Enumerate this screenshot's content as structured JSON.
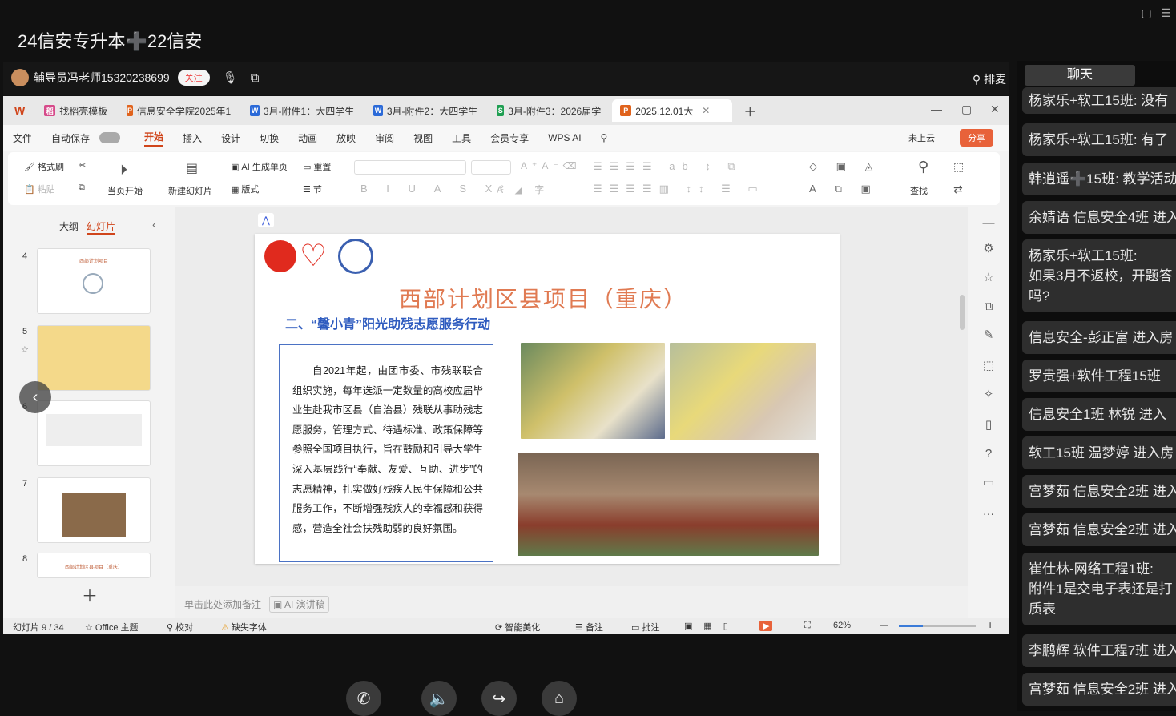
{
  "meeting": {
    "group_title": "24信安专升本➕22信安",
    "sharer_name": "辅导员冯老师15320238699",
    "follow_label": "关注",
    "rank_label": "排麦"
  },
  "wps": {
    "tabs": [
      {
        "label": "找稻壳模板",
        "icon": "docer-icon",
        "color": "#d64a8a"
      },
      {
        "label": "信息安全学院2025年1",
        "icon": "ppt-icon",
        "color": "#e0631d"
      },
      {
        "label": "3月-附件1：大四学生",
        "icon": "word-icon",
        "color": "#2b6ad8"
      },
      {
        "label": "3月-附件2：大四学生",
        "icon": "word-icon",
        "color": "#2b6ad8"
      },
      {
        "label": "3月-附件3：2026届学",
        "icon": "excel-icon",
        "color": "#1f9f52"
      },
      {
        "label": "2025.12.01大",
        "icon": "ppt-icon",
        "color": "#e0631d"
      }
    ],
    "menu": [
      "文件",
      "自动保存",
      "开始",
      "插入",
      "设计",
      "切换",
      "动画",
      "放映",
      "审阅",
      "视图",
      "工具",
      "会员专享",
      "WPS AI"
    ],
    "cloud_label": "未上云",
    "share_label": "分享",
    "ribbon": {
      "format_painter": "格式刷",
      "paste": "粘贴",
      "play_from_current": "当页开始",
      "new_slide": "新建幻灯片",
      "ai_generate": "AI 生成单页",
      "reset": "重置",
      "layout": "版式",
      "section": "节",
      "find": "查找"
    },
    "panel_tabs": {
      "outline": "大纲",
      "slides": "幻灯片"
    },
    "thumbnails": [
      {
        "num": "4",
        "title": "西部计划项目"
      },
      {
        "num": "5",
        "title": ""
      },
      {
        "num": "6",
        "title": ""
      },
      {
        "num": "7",
        "title": ""
      },
      {
        "num": "8",
        "title": "西部计划区县项目（重庆）"
      }
    ],
    "slide": {
      "title": "西部计划区县项目（重庆）",
      "subtitle": "二、“馨小青”阳光助残志愿服务行动",
      "body": "自2021年起，由团市委、市残联联合组织实施，每年选派一定数量的高校应届毕业生赴我市区县（自治县）残联从事助残志愿服务，管理方式、待遇标准、政策保障等参照全国项目执行，旨在鼓励和引导大学生深入基层践行“奉献、友爱、互助、进步”的志愿精神，扎实做好残疾人民生保障和公共服务工作，不断增强残疾人的幸福感和获得感，营造全社会扶残助弱的良好氛围。"
    },
    "notes_placeholder": "单击此处添加备注",
    "ai_notes": "AI 演讲稿",
    "status": {
      "slide_counter": "幻灯片 9 / 34",
      "theme": "Office 主题",
      "proof": "校对",
      "missing_font": "缺失字体",
      "beautify": "智能美化",
      "notes": "备注",
      "comments": "批注",
      "zoom": "62%"
    }
  },
  "chat": {
    "header": "聊天",
    "messages": [
      "杨家乐+软工15班: 没有",
      "杨家乐+软工15班: 有了",
      "韩逍遥➕15班: 教学活动",
      "余婧语 信息安全4班 进入",
      "杨家乐+软工15班:\n如果3月不返校，开题答\n吗?",
      "信息安全-彭正富 进入房",
      "罗贵强+软件工程15班",
      "信息安全1班 林锐 进入",
      "软工15班 温梦婷 进入房",
      "宫梦茹 信息安全2班 进入",
      "宫梦茹 信息安全2班 进入",
      "崔仕林-网络工程1班:\n附件1是交电子表还是打\n质表",
      "李鹏辉 软件工程7班 进入",
      "宫梦茹 信息安全2班 进入"
    ]
  },
  "colors": {
    "accent_orange": "#d0451b",
    "slide_title": "#e07a52",
    "slide_subtitle": "#2e5bbf"
  }
}
